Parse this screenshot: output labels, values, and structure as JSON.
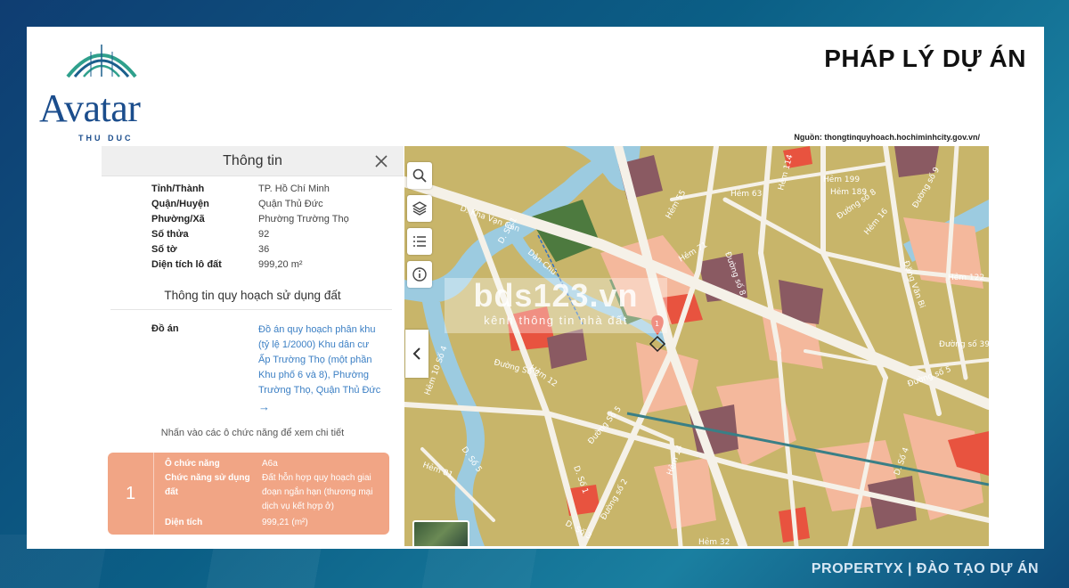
{
  "slide": {
    "title": "PHÁP LÝ DỰ ÁN",
    "source": "Nguồn: thongtinquyhoach.hochiminhcity.gov.vn/",
    "footer": "PROPERTYX | ĐÀO TẠO DỰ ÁN"
  },
  "logo": {
    "name": "Avatar",
    "sub": "THU DUC"
  },
  "panel": {
    "title": "Thông tin",
    "fields": [
      {
        "label": "Tỉnh/Thành",
        "value": "TP. Hồ Chí Minh"
      },
      {
        "label": "Quận/Huyện",
        "value": "Quận Thủ Đức"
      },
      {
        "label": "Phường/Xã",
        "value": "Phường Trường Thọ"
      },
      {
        "label": "Số thửa",
        "value": "92"
      },
      {
        "label": "Số tờ",
        "value": "36"
      },
      {
        "label": "Diện tích lô đất",
        "value": "999,20 m²"
      }
    ],
    "planning_title": "Thông tin quy hoạch sử dụng đất",
    "doan_label": "Đồ án",
    "doan_text": "Đồ án quy hoạch phân khu (tỷ lệ 1/2000) Khu dân cư Ấp Trường Thọ (một phần Khu phố 6 và 8), Phường Trường Thọ, Quận Thủ Đức",
    "doan_arrow": "→",
    "hint": "Nhấn vào các ô chức năng để xem chi tiết",
    "function_card": {
      "index": "1",
      "rows": [
        {
          "label": "Ô chức năng",
          "value": "A6a"
        },
        {
          "label": "Chức năng sử dụng đất",
          "value": "Đất hỗn hợp quy hoạch giai đoạn ngắn hạn (thương mại dịch vụ kết hợp ở)"
        },
        {
          "label": "Diện tích",
          "value": "999,21 (m²)"
        }
      ]
    }
  },
  "map": {
    "tools": [
      "search-icon",
      "layers-icon",
      "list-icon",
      "info-icon"
    ],
    "marker_label": "1",
    "watermark": {
      "main": "bds123.vn",
      "sub": "kênh thông tin nhà đất"
    },
    "streets": [
      "Hẻm 63",
      "Hẻm 199",
      "Hẻm 189",
      "Đường số 8",
      "Đường số 9",
      "Đặng Văn Bi",
      "Hẻm 71",
      "Đường số 8",
      "Hẻm 16",
      "Hẻm 55",
      "D. Số 1",
      "D. Kha Vạn Cân",
      "Đường số 39",
      "Đường số 5",
      "Hẻm 10 Số 4",
      "Đường Số 2",
      "Hẻm 12",
      "Hẻm 81",
      "Đường Số 5",
      "D. Số 3",
      "Hẻm 14",
      "D. Số 4",
      "Đường số 2",
      "D. Số 1",
      "Hẻm 32",
      "D. Số 5",
      "Hẻm 122",
      "Hẻm 114",
      "Dân Chủ",
      "Hẻm 24",
      "Thủ"
    ],
    "colors": {
      "residential": "#c8b56a",
      "mixed": "#f4b89c",
      "commercial": "#e8533f",
      "public": "#8a5a62",
      "green": "#4d7a3f",
      "water": "#9ccbe0",
      "road": "#f5f1e8"
    }
  }
}
